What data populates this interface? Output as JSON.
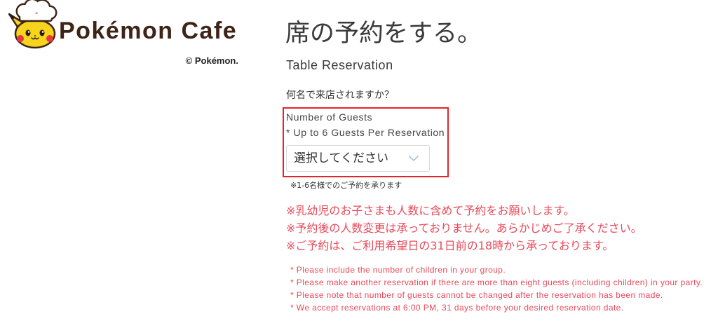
{
  "brand": {
    "name": "Pokémon Cafe",
    "copyright": "© Pokémon."
  },
  "heading": {
    "title_ja": "席の予約をする。",
    "title_en": "Table Reservation"
  },
  "guests": {
    "question_ja": "何名で来店されますか？",
    "label_en": "Number of Guests",
    "limit_en": "* Up to 6 Guests Per Reservation",
    "select_value": "選択してください",
    "note_ja": "※1-6名様でのご予約を承ります"
  },
  "notices_ja": [
    "※乳幼児のお子さまも人数に含めて予約をお願いします。",
    "※予約後の人数変更は承っておりません。あらかじめご了承ください。",
    "※ご予約は、ご利用希望日の31日前の18時から承っております。"
  ],
  "notices_en": [
    "* Please include the number of children in your group.",
    "* Please make another reservation if there are more than eight guests (including children) in your party.",
    "* Please note that number of guests cannot be changed after the reservation has been made.",
    "* We accept reservations at 6:00 PM, 31 days before your desired reservation date."
  ],
  "colors": {
    "brand_brown": "#3e2417",
    "pikachu_yellow": "#f7d51d",
    "highlight_border": "#e2252b",
    "notice_red": "#e9495a",
    "text": "#333333",
    "chevron": "#9bb7cf"
  },
  "icons": {
    "logo": "pikachu-chef-icon",
    "select": "chevron-down-icon"
  }
}
